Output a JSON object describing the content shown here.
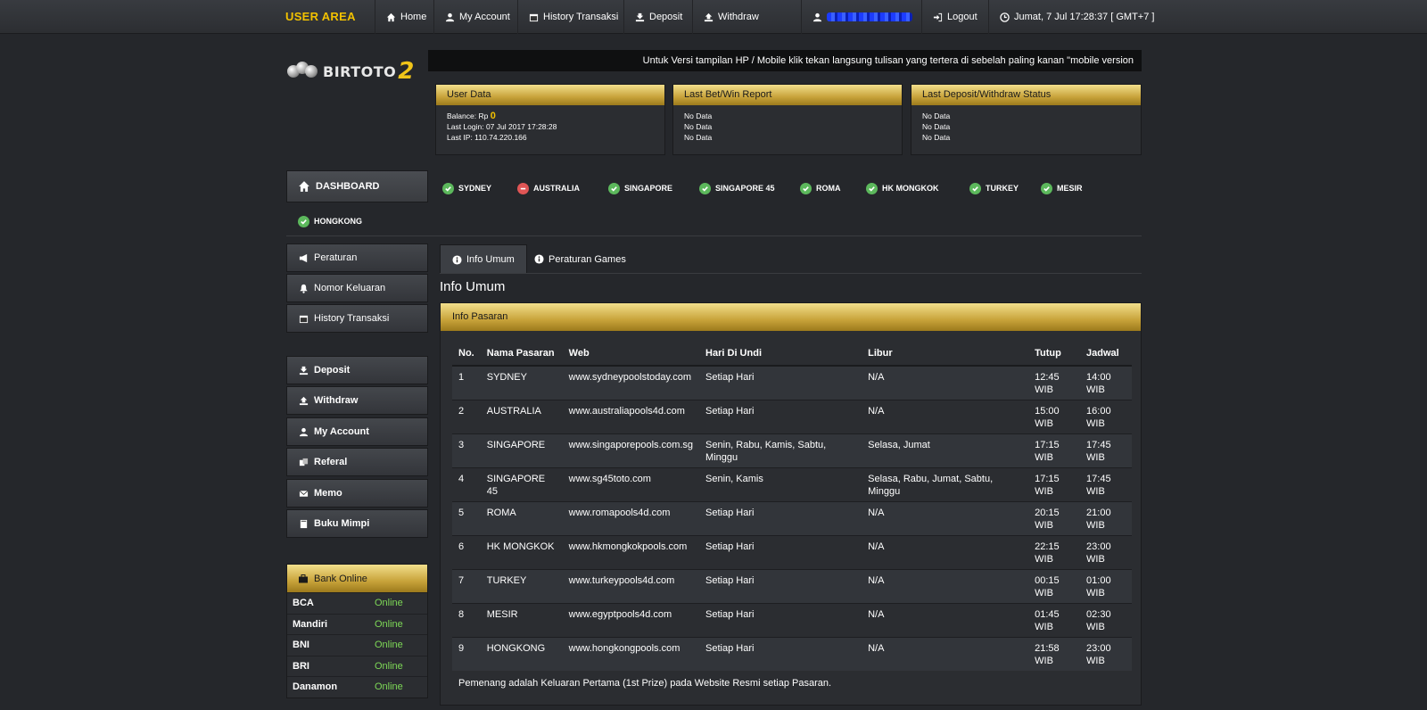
{
  "topnav": {
    "brand": "USER AREA",
    "items": [
      {
        "label": "Home",
        "icon": "home-icon"
      },
      {
        "label": "My Account",
        "icon": "user-icon"
      },
      {
        "label": "History Transaksi",
        "icon": "calendar-icon"
      },
      {
        "label": "Deposit",
        "icon": "deposit-icon"
      },
      {
        "label": "Withdraw",
        "icon": "withdraw-icon"
      }
    ],
    "logout": "Logout",
    "datetime": "Jumat, 7 Jul 17:28:37 [ GMT+7 ]"
  },
  "logo": {
    "name": "BIRTOTO",
    "num": "2"
  },
  "marquee": "Untuk Versi tampilan HP / Mobile klik tekan langsung tulisan yang tertera di sebelah paling kanan \"mobile version",
  "panels": {
    "user": {
      "title": "User Data",
      "balance_label": "Balance: Rp",
      "balance_value": "0",
      "last_login": "Last Login: 07 Jul 2017 17:28:28",
      "last_ip": "Last IP: 110.74.220.166"
    },
    "bet": {
      "title": "Last Bet/Win Report",
      "lines": [
        "No Data",
        "No Data",
        "No Data"
      ]
    },
    "deposit": {
      "title": "Last Deposit/Withdraw Status",
      "lines": [
        "No Data",
        "No Data",
        "No Data"
      ]
    }
  },
  "dashboard": "DASHBOARD",
  "markets": [
    {
      "name": "SYDNEY",
      "status": "ok"
    },
    {
      "name": "AUSTRALIA",
      "status": "closed"
    },
    {
      "name": "SINGAPORE",
      "status": "ok"
    },
    {
      "name": "SINGAPORE 45",
      "status": "ok"
    },
    {
      "name": "ROMA",
      "status": "ok"
    },
    {
      "name": "HK MONGKOK",
      "status": "ok"
    },
    {
      "name": "TURKEY",
      "status": "ok"
    },
    {
      "name": "MESIR",
      "status": "ok"
    },
    {
      "name": "HONGKONG",
      "status": "ok"
    }
  ],
  "sidemenu": {
    "group1": [
      {
        "label": "Peraturan",
        "icon": "megaphone-icon"
      },
      {
        "label": "Nomor Keluaran",
        "icon": "bell-icon"
      },
      {
        "label": "History Transaksi",
        "icon": "calendar-icon"
      }
    ],
    "group2": [
      {
        "label": "Deposit",
        "icon": "deposit-icon"
      },
      {
        "label": "Withdraw",
        "icon": "withdraw-icon"
      },
      {
        "label": "My Account",
        "icon": "user-icon"
      },
      {
        "label": "Referal",
        "icon": "referal-icon"
      },
      {
        "label": "Memo",
        "icon": "envelope-icon"
      },
      {
        "label": "Buku Mimpi",
        "icon": "book-icon"
      }
    ]
  },
  "bank": {
    "title": "Bank Online",
    "rows": [
      {
        "name": "BCA",
        "status": "Online"
      },
      {
        "name": "Mandiri",
        "status": "Online"
      },
      {
        "name": "BNI",
        "status": "Online"
      },
      {
        "name": "BRI",
        "status": "Online"
      },
      {
        "name": "Danamon",
        "status": "Online"
      }
    ]
  },
  "tabs": [
    "Info Umum",
    "Peraturan Games"
  ],
  "page_title": "Info Umum",
  "info": {
    "title": "Info Pasaran",
    "columns": [
      "No.",
      "Nama Pasaran",
      "Web",
      "Hari Di Undi",
      "Libur",
      "Tutup",
      "Jadwal"
    ],
    "rows": [
      [
        "1",
        "SYDNEY",
        "www.sydneypoolstoday.com",
        "Setiap Hari",
        "N/A",
        "12:45 WIB",
        "14:00 WIB"
      ],
      [
        "2",
        "AUSTRALIA",
        "www.australiapools4d.com",
        "Setiap Hari",
        "N/A",
        "15:00 WIB",
        "16:00 WIB"
      ],
      [
        "3",
        "SINGAPORE",
        "www.singaporepools.com.sg",
        "Senin, Rabu, Kamis, Sabtu, Minggu",
        "Selasa, Jumat",
        "17:15 WIB",
        "17:45 WIB"
      ],
      [
        "4",
        "SINGAPORE 45",
        "www.sg45toto.com",
        "Senin, Kamis",
        "Selasa, Rabu, Jumat, Sabtu, Minggu",
        "17:15 WIB",
        "17:45 WIB"
      ],
      [
        "5",
        "ROMA",
        "www.romapools4d.com",
        "Setiap Hari",
        "N/A",
        "20:15 WIB",
        "21:00 WIB"
      ],
      [
        "6",
        "HK MONGKOK",
        "www.hkmongkokpools.com",
        "Setiap Hari",
        "N/A",
        "22:15 WIB",
        "23:00 WIB"
      ],
      [
        "7",
        "TURKEY",
        "www.turkeypools4d.com",
        "Setiap Hari",
        "N/A",
        "00:15 WIB",
        "01:00 WIB"
      ],
      [
        "8",
        "MESIR",
        "www.egyptpools4d.com",
        "Setiap Hari",
        "N/A",
        "01:45 WIB",
        "02:30 WIB"
      ],
      [
        "9",
        "HONGKONG",
        "www.hongkongpools.com",
        "Setiap Hari",
        "N/A",
        "21:58 WIB",
        "23:00 WIB"
      ]
    ],
    "footnote": "Pemenang adalah Keluaran Pertama (1st Prize) pada Website Resmi setiap Pasaran."
  },
  "colors": {
    "accent": "#f2c100",
    "ok": "#5cb85c",
    "closed": "#e05555",
    "online": "#7ed957"
  }
}
